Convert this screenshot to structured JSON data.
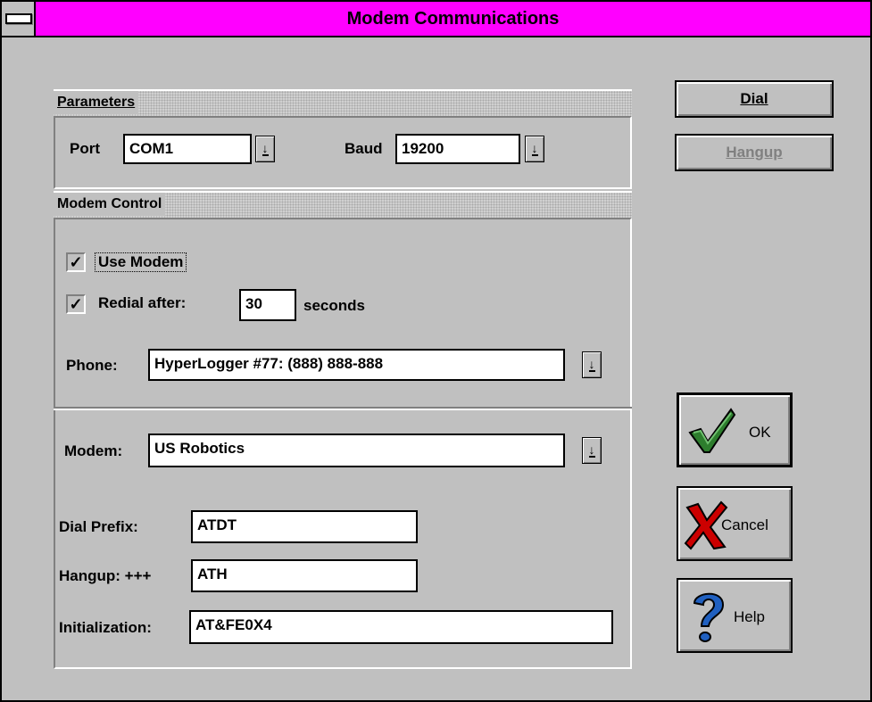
{
  "window": {
    "title": "Modem Communications"
  },
  "parameters": {
    "heading": "Parameters",
    "port_label": "Port",
    "port_value": "COM1",
    "baud_label": "Baud",
    "baud_value": "19200"
  },
  "modem_control": {
    "heading": "Modem Control",
    "use_modem_label": "Use Modem",
    "use_modem_checked": true,
    "redial_label": "Redial after:",
    "redial_checked": true,
    "redial_value": "30",
    "seconds_label": "seconds",
    "phone_label": "Phone:",
    "phone_value": "HyperLogger #77:  (888) 888-888",
    "modem_label": "Modem:",
    "modem_value": "US Robotics",
    "dial_prefix_label": "Dial Prefix:",
    "dial_prefix_value": "ATDT",
    "hangup_label": "Hangup: +++",
    "hangup_value": "ATH",
    "init_label": "Initialization:",
    "init_value": "AT&FE0X4"
  },
  "buttons": {
    "dial": "Dial",
    "hangup": "Hangup",
    "ok": "OK",
    "cancel": "Cancel",
    "help": "Help"
  },
  "colors": {
    "titlebar": "#ff00ff",
    "face": "#c0c0c0",
    "ok_check": "#2d7d2d",
    "cancel_x": "#cc0000",
    "help_q": "#2060c0"
  }
}
